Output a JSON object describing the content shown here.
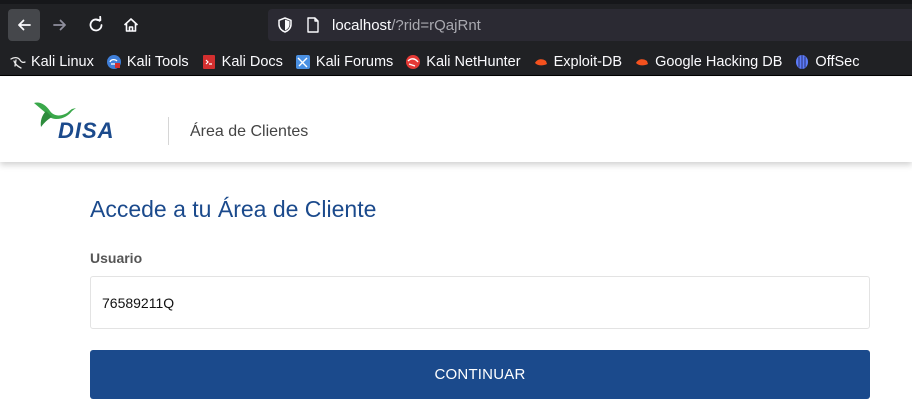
{
  "browser": {
    "url_host": "localhost",
    "url_path": "/?rid=rQajRnt"
  },
  "bookmarks": [
    {
      "label": "Kali Linux",
      "icon": "kali-dragon-icon",
      "color": "#e8e8e8"
    },
    {
      "label": "Kali Tools",
      "icon": "kali-tools-icon",
      "color": "#3f7fd9"
    },
    {
      "label": "Kali Docs",
      "icon": "kali-docs-icon",
      "color": "#d32f2f"
    },
    {
      "label": "Kali Forums",
      "icon": "kali-forums-icon",
      "color": "#4a90e2"
    },
    {
      "label": "Kali NetHunter",
      "icon": "nethunter-icon",
      "color": "#e53935"
    },
    {
      "label": "Exploit-DB",
      "icon": "exploit-db-icon",
      "color": "#f4511e"
    },
    {
      "label": "Google Hacking DB",
      "icon": "ghdb-icon",
      "color": "#f4511e"
    },
    {
      "label": "OffSec",
      "icon": "offsec-icon",
      "color": "#5c7cfa"
    }
  ],
  "header": {
    "logo_text": "DISA",
    "title": "Área de Clientes"
  },
  "main": {
    "title": "Accede a tu Área de Cliente",
    "user_label": "Usuario",
    "user_value": "76589211Q",
    "continue_label": "CONTINUAR"
  },
  "colors": {
    "brand_blue": "#1b4a8c",
    "brand_green": "#3aa84a"
  }
}
